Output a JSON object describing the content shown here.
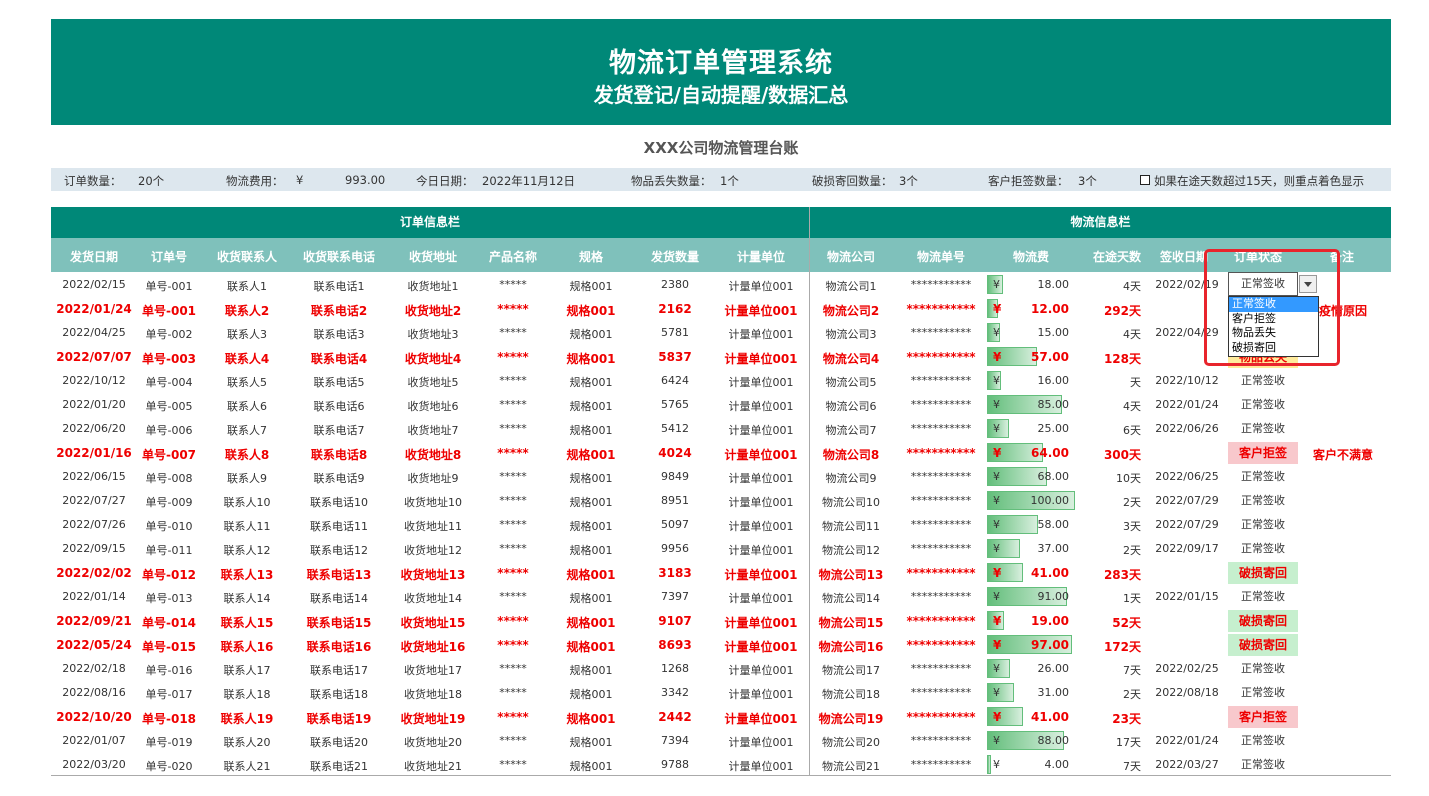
{
  "banner": {
    "title": "物流订单管理系统",
    "subtitle": "发货登记/自动提醒/数据汇总"
  },
  "sheet_title": "XXX公司物流管理台账",
  "summary": {
    "order_count_label": "订单数量：",
    "order_count_value": "20个",
    "freight_label": "物流费用：",
    "freight_currency": "¥",
    "freight_value": "993.00",
    "today_label": "今日日期：",
    "today_value": "2022年11月12日",
    "lost_label": "物品丢失数量：",
    "lost_value": "1个",
    "damaged_label": "破损寄回数量：",
    "damaged_value": "3个",
    "rejected_label": "客户拒签数量：",
    "rejected_value": "3个",
    "highlight_checkbox_label": "如果在途天数超过15天，则重点着色显示"
  },
  "groups": {
    "order_info": "订单信息栏",
    "logistics_info": "物流信息栏"
  },
  "headers": [
    "发货日期",
    "订单号",
    "收货联系人",
    "收货联系电话",
    "收货地址",
    "产品名称",
    "规格",
    "发货数量",
    "计量单位",
    "物流公司",
    "物流单号",
    "物流费",
    "在途天数",
    "签收日期",
    "订单状态",
    "备注"
  ],
  "colors": {
    "teal": "#008878",
    "header_teal": "#7fc1bb",
    "highlight_red": "#e00000",
    "pink": "#f8c8cc",
    "green": "#c6efce",
    "yellow": "#ffeb9c"
  },
  "dropdown": {
    "current": "正常签收",
    "options": [
      "正常签收",
      "客户拒签",
      "物品丢失",
      "破损寄回"
    ],
    "selected_index": 0
  },
  "rows": [
    {
      "date": "2022/02/15",
      "order": "单号-001",
      "contact": "联系人1",
      "phone": "联系电话1",
      "addr": "收货地址1",
      "product": "*****",
      "spec": "规格001",
      "qty": "2380",
      "unit": "计量单位001",
      "company": "物流公司1",
      "tracking": "***********",
      "currency": "¥",
      "fee": "18.00",
      "fee_num": 18,
      "days": "4天",
      "sign": "2022/02/19",
      "status": "正常签收",
      "note": "",
      "hl": false,
      "st": ""
    },
    {
      "date": "2022/01/24",
      "order": "单号-001",
      "contact": "联系人2",
      "phone": "联系电话2",
      "addr": "收货地址2",
      "product": "*****",
      "spec": "规格001",
      "qty": "2162",
      "unit": "计量单位001",
      "company": "物流公司2",
      "tracking": "***********",
      "currency": "¥",
      "fee": "12.00",
      "fee_num": 12,
      "days": "292天",
      "sign": "",
      "status": "",
      "note": "疫情原因",
      "hl": true,
      "st": ""
    },
    {
      "date": "2022/04/25",
      "order": "单号-002",
      "contact": "联系人3",
      "phone": "联系电话3",
      "addr": "收货地址3",
      "product": "*****",
      "spec": "规格001",
      "qty": "5781",
      "unit": "计量单位001",
      "company": "物流公司3",
      "tracking": "***********",
      "currency": "¥",
      "fee": "15.00",
      "fee_num": 15,
      "days": "4天",
      "sign": "2022/04/29",
      "status": "",
      "note": "",
      "hl": false,
      "st": ""
    },
    {
      "date": "2022/07/07",
      "order": "单号-003",
      "contact": "联系人4",
      "phone": "联系电话4",
      "addr": "收货地址4",
      "product": "*****",
      "spec": "规格001",
      "qty": "5837",
      "unit": "计量单位001",
      "company": "物流公司4",
      "tracking": "***********",
      "currency": "¥",
      "fee": "57.00",
      "fee_num": 57,
      "days": "128天",
      "sign": "",
      "status": "物品丢失",
      "note": "",
      "hl": true,
      "st": "yellow"
    },
    {
      "date": "2022/10/12",
      "order": "单号-004",
      "contact": "联系人5",
      "phone": "联系电话5",
      "addr": "收货地址5",
      "product": "*****",
      "spec": "规格001",
      "qty": "6424",
      "unit": "计量单位001",
      "company": "物流公司5",
      "tracking": "***********",
      "currency": "¥",
      "fee": "16.00",
      "fee_num": 16,
      "days": "天",
      "sign": "2022/10/12",
      "status": "正常签收",
      "note": "",
      "hl": false,
      "st": ""
    },
    {
      "date": "2022/01/20",
      "order": "单号-005",
      "contact": "联系人6",
      "phone": "联系电话6",
      "addr": "收货地址6",
      "product": "*****",
      "spec": "规格001",
      "qty": "5765",
      "unit": "计量单位001",
      "company": "物流公司6",
      "tracking": "***********",
      "currency": "¥",
      "fee": "85.00",
      "fee_num": 85,
      "days": "4天",
      "sign": "2022/01/24",
      "status": "正常签收",
      "note": "",
      "hl": false,
      "st": ""
    },
    {
      "date": "2022/06/20",
      "order": "单号-006",
      "contact": "联系人7",
      "phone": "联系电话7",
      "addr": "收货地址7",
      "product": "*****",
      "spec": "规格001",
      "qty": "5412",
      "unit": "计量单位001",
      "company": "物流公司7",
      "tracking": "***********",
      "currency": "¥",
      "fee": "25.00",
      "fee_num": 25,
      "days": "6天",
      "sign": "2022/06/26",
      "status": "正常签收",
      "note": "",
      "hl": false,
      "st": ""
    },
    {
      "date": "2022/01/16",
      "order": "单号-007",
      "contact": "联系人8",
      "phone": "联系电话8",
      "addr": "收货地址8",
      "product": "*****",
      "spec": "规格001",
      "qty": "4024",
      "unit": "计量单位001",
      "company": "物流公司8",
      "tracking": "***********",
      "currency": "¥",
      "fee": "64.00",
      "fee_num": 64,
      "days": "300天",
      "sign": "",
      "status": "客户拒签",
      "note": "客户不满意",
      "hl": true,
      "st": "pink"
    },
    {
      "date": "2022/06/15",
      "order": "单号-008",
      "contact": "联系人9",
      "phone": "联系电话9",
      "addr": "收货地址9",
      "product": "*****",
      "spec": "规格001",
      "qty": "9849",
      "unit": "计量单位001",
      "company": "物流公司9",
      "tracking": "***********",
      "currency": "¥",
      "fee": "68.00",
      "fee_num": 68,
      "days": "10天",
      "sign": "2022/06/25",
      "status": "正常签收",
      "note": "",
      "hl": false,
      "st": ""
    },
    {
      "date": "2022/07/27",
      "order": "单号-009",
      "contact": "联系人10",
      "phone": "联系电话10",
      "addr": "收货地址10",
      "product": "*****",
      "spec": "规格001",
      "qty": "8951",
      "unit": "计量单位001",
      "company": "物流公司10",
      "tracking": "***********",
      "currency": "¥",
      "fee": "100.00",
      "fee_num": 100,
      "days": "2天",
      "sign": "2022/07/29",
      "status": "正常签收",
      "note": "",
      "hl": false,
      "st": ""
    },
    {
      "date": "2022/07/26",
      "order": "单号-010",
      "contact": "联系人11",
      "phone": "联系电话11",
      "addr": "收货地址11",
      "product": "*****",
      "spec": "规格001",
      "qty": "5097",
      "unit": "计量单位001",
      "company": "物流公司11",
      "tracking": "***********",
      "currency": "¥",
      "fee": "58.00",
      "fee_num": 58,
      "days": "3天",
      "sign": "2022/07/29",
      "status": "正常签收",
      "note": "",
      "hl": false,
      "st": ""
    },
    {
      "date": "2022/09/15",
      "order": "单号-011",
      "contact": "联系人12",
      "phone": "联系电话12",
      "addr": "收货地址12",
      "product": "*****",
      "spec": "规格001",
      "qty": "9956",
      "unit": "计量单位001",
      "company": "物流公司12",
      "tracking": "***********",
      "currency": "¥",
      "fee": "37.00",
      "fee_num": 37,
      "days": "2天",
      "sign": "2022/09/17",
      "status": "正常签收",
      "note": "",
      "hl": false,
      "st": ""
    },
    {
      "date": "2022/02/02",
      "order": "单号-012",
      "contact": "联系人13",
      "phone": "联系电话13",
      "addr": "收货地址13",
      "product": "*****",
      "spec": "规格001",
      "qty": "3183",
      "unit": "计量单位001",
      "company": "物流公司13",
      "tracking": "***********",
      "currency": "¥",
      "fee": "41.00",
      "fee_num": 41,
      "days": "283天",
      "sign": "",
      "status": "破损寄回",
      "note": "",
      "hl": true,
      "st": "green"
    },
    {
      "date": "2022/01/14",
      "order": "单号-013",
      "contact": "联系人14",
      "phone": "联系电话14",
      "addr": "收货地址14",
      "product": "*****",
      "spec": "规格001",
      "qty": "7397",
      "unit": "计量单位001",
      "company": "物流公司14",
      "tracking": "***********",
      "currency": "¥",
      "fee": "91.00",
      "fee_num": 91,
      "days": "1天",
      "sign": "2022/01/15",
      "status": "正常签收",
      "note": "",
      "hl": false,
      "st": ""
    },
    {
      "date": "2022/09/21",
      "order": "单号-014",
      "contact": "联系人15",
      "phone": "联系电话15",
      "addr": "收货地址15",
      "product": "*****",
      "spec": "规格001",
      "qty": "9107",
      "unit": "计量单位001",
      "company": "物流公司15",
      "tracking": "***********",
      "currency": "¥",
      "fee": "19.00",
      "fee_num": 19,
      "days": "52天",
      "sign": "",
      "status": "破损寄回",
      "note": "",
      "hl": true,
      "st": "green"
    },
    {
      "date": "2022/05/24",
      "order": "单号-015",
      "contact": "联系人16",
      "phone": "联系电话16",
      "addr": "收货地址16",
      "product": "*****",
      "spec": "规格001",
      "qty": "8693",
      "unit": "计量单位001",
      "company": "物流公司16",
      "tracking": "***********",
      "currency": "¥",
      "fee": "97.00",
      "fee_num": 97,
      "days": "172天",
      "sign": "",
      "status": "破损寄回",
      "note": "",
      "hl": true,
      "st": "green"
    },
    {
      "date": "2022/02/18",
      "order": "单号-016",
      "contact": "联系人17",
      "phone": "联系电话17",
      "addr": "收货地址17",
      "product": "*****",
      "spec": "规格001",
      "qty": "1268",
      "unit": "计量单位001",
      "company": "物流公司17",
      "tracking": "***********",
      "currency": "¥",
      "fee": "26.00",
      "fee_num": 26,
      "days": "7天",
      "sign": "2022/02/25",
      "status": "正常签收",
      "note": "",
      "hl": false,
      "st": ""
    },
    {
      "date": "2022/08/16",
      "order": "单号-017",
      "contact": "联系人18",
      "phone": "联系电话18",
      "addr": "收货地址18",
      "product": "*****",
      "spec": "规格001",
      "qty": "3342",
      "unit": "计量单位001",
      "company": "物流公司18",
      "tracking": "***********",
      "currency": "¥",
      "fee": "31.00",
      "fee_num": 31,
      "days": "2天",
      "sign": "2022/08/18",
      "status": "正常签收",
      "note": "",
      "hl": false,
      "st": ""
    },
    {
      "date": "2022/10/20",
      "order": "单号-018",
      "contact": "联系人19",
      "phone": "联系电话19",
      "addr": "收货地址19",
      "product": "*****",
      "spec": "规格001",
      "qty": "2442",
      "unit": "计量单位001",
      "company": "物流公司19",
      "tracking": "***********",
      "currency": "¥",
      "fee": "41.00",
      "fee_num": 41,
      "days": "23天",
      "sign": "",
      "status": "客户拒签",
      "note": "",
      "hl": true,
      "st": "pink"
    },
    {
      "date": "2022/01/07",
      "order": "单号-019",
      "contact": "联系人20",
      "phone": "联系电话20",
      "addr": "收货地址20",
      "product": "*****",
      "spec": "规格001",
      "qty": "7394",
      "unit": "计量单位001",
      "company": "物流公司20",
      "tracking": "***********",
      "currency": "¥",
      "fee": "88.00",
      "fee_num": 88,
      "days": "17天",
      "sign": "2022/01/24",
      "status": "正常签收",
      "note": "",
      "hl": false,
      "st": ""
    },
    {
      "date": "2022/03/20",
      "order": "单号-020",
      "contact": "联系人21",
      "phone": "联系电话21",
      "addr": "收货地址21",
      "product": "*****",
      "spec": "规格001",
      "qty": "9788",
      "unit": "计量单位001",
      "company": "物流公司21",
      "tracking": "***********",
      "currency": "¥",
      "fee": "4.00",
      "fee_num": 4,
      "days": "7天",
      "sign": "2022/03/27",
      "status": "正常签收",
      "note": "",
      "hl": false,
      "st": ""
    }
  ]
}
